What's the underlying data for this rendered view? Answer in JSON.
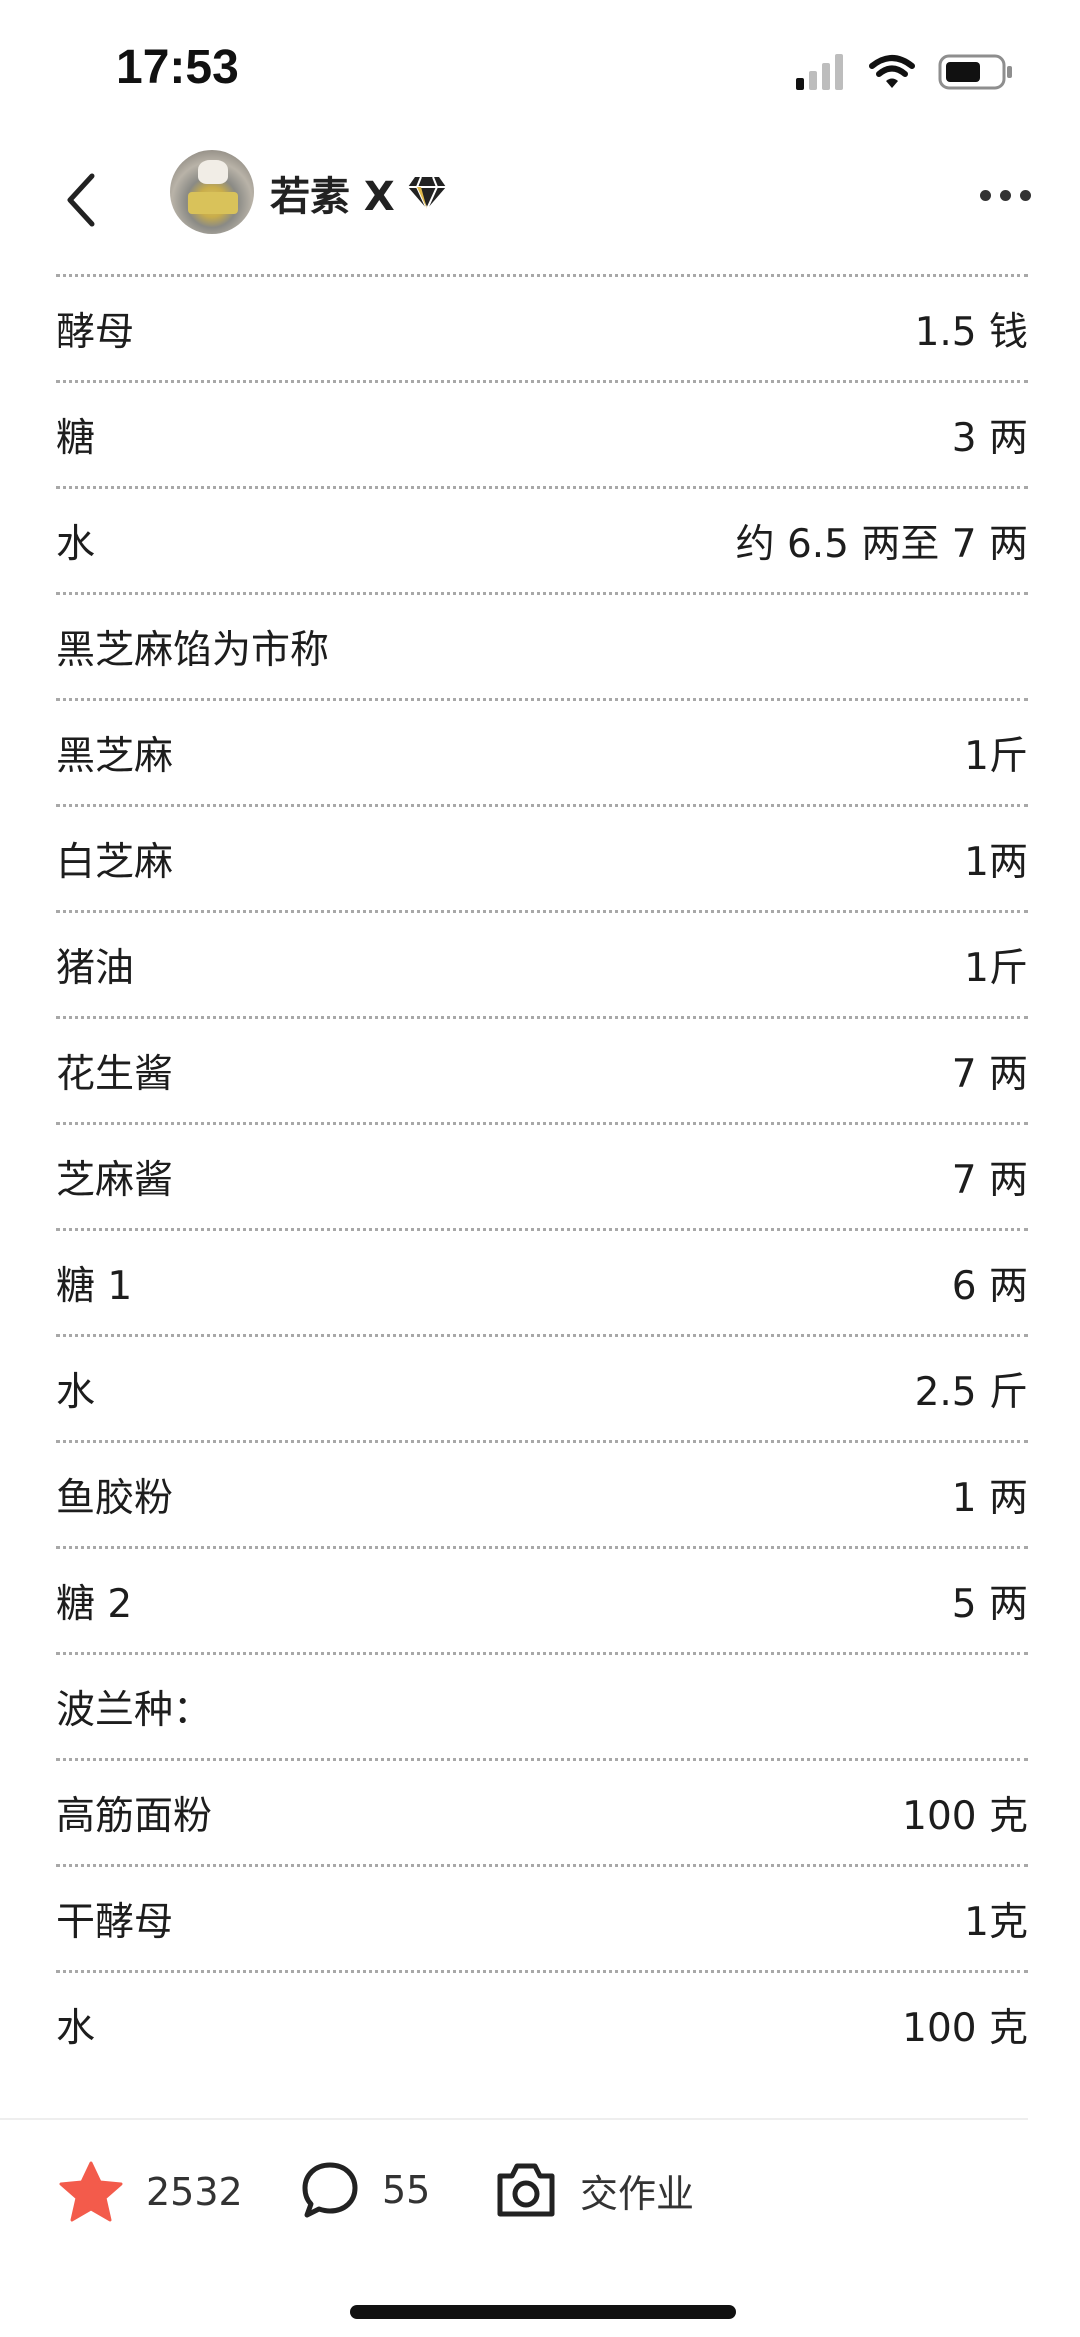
{
  "status_bar": {
    "time": "17:53"
  },
  "header": {
    "author_name": "若素 X"
  },
  "ingredients": [
    {
      "name": "酵母",
      "qty": "1.5 钱"
    },
    {
      "name": "糖",
      "qty": "3 两"
    },
    {
      "name": "水",
      "qty": "约 6.5 两至 7 两"
    },
    {
      "name": "黑芝麻馅为市称",
      "qty": ""
    },
    {
      "name": "黑芝麻",
      "qty": "1斤"
    },
    {
      "name": "白芝麻",
      "qty": "1两"
    },
    {
      "name": "猪油",
      "qty": "1斤"
    },
    {
      "name": "花生酱",
      "qty": "7 两"
    },
    {
      "name": "芝麻酱",
      "qty": "7 两"
    },
    {
      "name": "糖 1",
      "qty": "6 两"
    },
    {
      "name": "水",
      "qty": "2.5 斤"
    },
    {
      "name": "鱼胶粉",
      "qty": "1 两"
    },
    {
      "name": "糖 2",
      "qty": "5 两"
    },
    {
      "name": "波兰种：",
      "qty": ""
    },
    {
      "name": "高筋面粉",
      "qty": "100 克"
    },
    {
      "name": "干酵母",
      "qty": "1克"
    },
    {
      "name": "水",
      "qty": "100 克"
    }
  ],
  "bottom_bar": {
    "like_count": "2532",
    "comment_count": "55",
    "homework_label": "交作业"
  },
  "colors": {
    "accent_star": "#f35b4b",
    "divider": "#a8a8a8"
  },
  "icons": [
    "back-arrow-icon",
    "cellular-signal-icon",
    "wifi-icon",
    "battery-icon",
    "verified-diamond-icon",
    "more-icon",
    "star-icon",
    "comment-icon",
    "camera-icon"
  ]
}
